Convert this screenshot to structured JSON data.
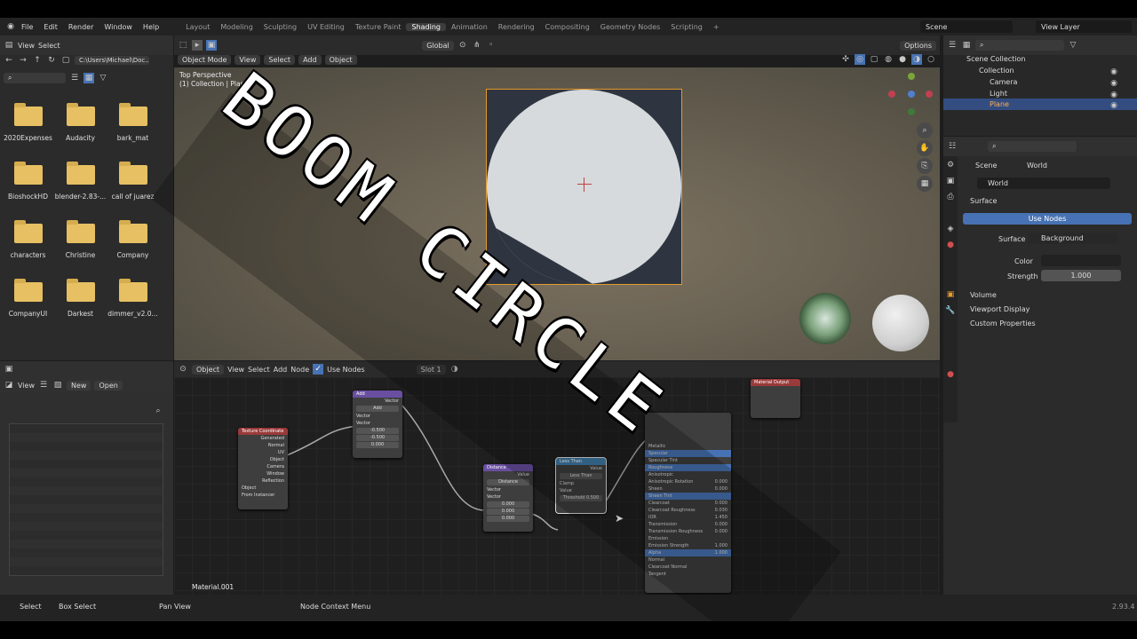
{
  "topbar": {
    "menu": [
      "File",
      "Edit",
      "Render",
      "Window",
      "Help"
    ],
    "workspaces": [
      "Layout",
      "Modeling",
      "Sculpting",
      "UV Editing",
      "Texture Paint",
      "Shading",
      "Animation",
      "Rendering",
      "Compositing",
      "Geometry Nodes",
      "Scripting"
    ],
    "active_workspace": "Shading",
    "scene": "Scene",
    "view_layer": "View Layer"
  },
  "file_browser": {
    "menu": [
      "View",
      "Select"
    ],
    "path": "C:\\Users\\Michael\\Doc...",
    "folders": [
      "2020Expenses",
      "Audacity",
      "bark_mat",
      "BioshockHD",
      "blender-2.83-...",
      "call of juarez",
      "characters",
      "Christine",
      "Company",
      "CompanyUI",
      "Darkest",
      "dimmer_v2.0..."
    ]
  },
  "viewport_header": {
    "mode": "Object Mode",
    "menu": [
      "View",
      "Select",
      "Add",
      "Object"
    ],
    "orientation": "Global",
    "options": "Options",
    "perspective": "Top Perspective",
    "collection": "(1) Collection | Plane"
  },
  "outliner": {
    "title": "Scene Collection",
    "items": [
      "Collection",
      "Camera",
      "Light",
      "Plane"
    ],
    "selected": "Plane"
  },
  "properties": {
    "tabs": [
      "Scene",
      "World"
    ],
    "world_name": "World",
    "surface_label": "Surface",
    "use_nodes": "Use Nodes",
    "surface_field": "Surface",
    "surface_value": "Background",
    "color_label": "Color",
    "strength_label": "Strength",
    "strength_value": "1.000",
    "sections": [
      "Volume",
      "Viewport Display",
      "Custom Properties"
    ]
  },
  "image_editor": {
    "view": "View",
    "new": "New",
    "open": "Open"
  },
  "node_editor": {
    "type": "Object",
    "menu": [
      "View",
      "Select",
      "Add",
      "Node"
    ],
    "use_nodes": "Use Nodes",
    "slot": "Slot 1",
    "material": "Material.001",
    "nodes": {
      "texcoord": {
        "title": "Texture Coordinate",
        "outputs": [
          "Generated",
          "Normal",
          "UV",
          "Object",
          "Camera",
          "Window",
          "Reflection"
        ],
        "object": "Object",
        "from_instancer": "From Instancer"
      },
      "add": {
        "title": "Add",
        "out": "Vector",
        "op": "Add",
        "inputs": [
          "Vector",
          "Vector"
        ],
        "values": [
          "-0.500",
          "-0.500",
          "0.000"
        ]
      },
      "distance": {
        "title": "Distance",
        "out": "Value",
        "op": "Distance",
        "inputs": [
          "Vector",
          "Vector"
        ],
        "values": [
          "0.000",
          "0.000",
          "0.000"
        ]
      },
      "lessthan": {
        "title": "Less Than",
        "out": "Value",
        "op": "Less Than",
        "clamp": "Clamp",
        "input": "Value",
        "threshold": "Threshold 0.500"
      },
      "bsdf": {
        "rows": [
          "Metallic",
          "Specular",
          "Specular Tint",
          "Roughness",
          "Anisotropic",
          "Anisotropic Rotation",
          "Sheen",
          "Sheen Tint",
          "Clearcoat",
          "Clearcoat Roughness",
          "IOR",
          "Transmission",
          "Transmission Roughness",
          "Emission",
          "Emission Strength",
          "Alpha",
          "Normal",
          "Clearcoat Normal",
          "Tangent"
        ],
        "values": [
          "",
          "",
          "",
          "",
          "",
          "0.000",
          "0.000",
          "",
          "0.000",
          "0.030",
          "1.450",
          "0.000",
          "0.000",
          "",
          "1.000",
          "1.000",
          "",
          "",
          ""
        ]
      },
      "output": {
        "title": "Material Output"
      }
    }
  },
  "statusbar": {
    "items": [
      "Select",
      "Box Select",
      "Pan View",
      "Node Context Menu"
    ],
    "version": "2.93.4"
  },
  "overlay": {
    "text": "BOOM CIRCLE"
  },
  "colors": {
    "accent": "#4772b3",
    "selection": "#e69a2a",
    "folder": "#e6c062"
  }
}
